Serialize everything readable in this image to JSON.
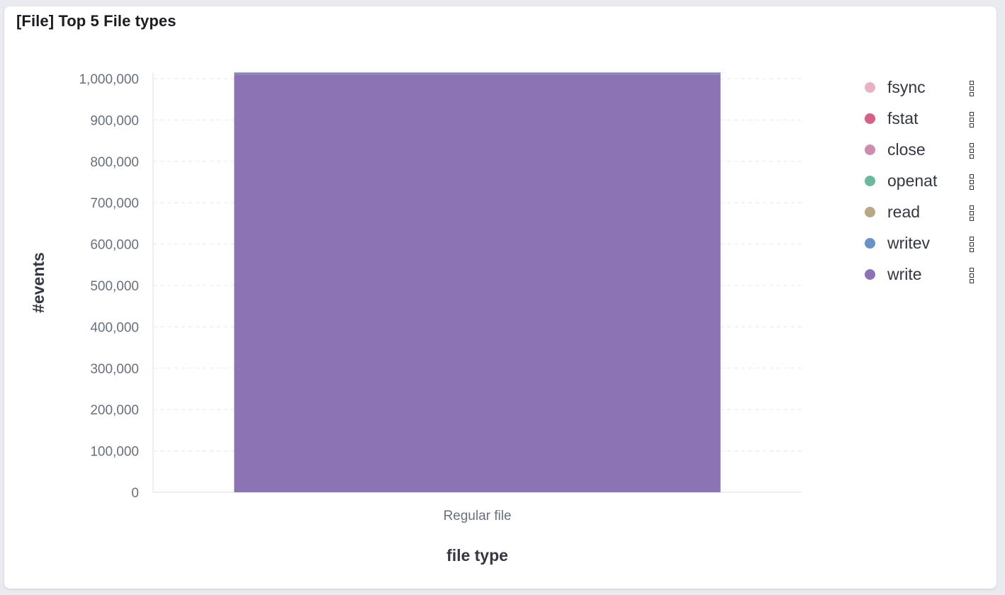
{
  "panel": {
    "title": "[File] Top 5 File types"
  },
  "chart_data": {
    "type": "bar",
    "stacked": true,
    "categories": [
      "Regular file"
    ],
    "xlabel": "file type",
    "ylabel": "#events",
    "ylim": [
      0,
      1000000
    ],
    "yticks": [
      "0",
      "100,000",
      "200,000",
      "300,000",
      "400,000",
      "500,000",
      "600,000",
      "700,000",
      "800,000",
      "900,000",
      "1,000,000"
    ],
    "grid": true,
    "legend_position": "right",
    "series": [
      {
        "name": "write",
        "color": "#8c73b4",
        "values": [
          1010000
        ]
      },
      {
        "name": "writev",
        "color": "#6a92c6",
        "values": [
          4000
        ]
      },
      {
        "name": "read",
        "color": "#b9a888",
        "values": [
          400
        ]
      },
      {
        "name": "openat",
        "color": "#6db79f",
        "values": [
          300
        ]
      },
      {
        "name": "close",
        "color": "#ca8eae",
        "values": [
          200
        ]
      },
      {
        "name": "fstat",
        "color": "#d36086",
        "values": [
          100
        ]
      },
      {
        "name": "fsync",
        "color": "#e7b2c4",
        "values": [
          50
        ]
      }
    ],
    "legend": [
      {
        "name": "fsync",
        "color": "#e7b2c4"
      },
      {
        "name": "fstat",
        "color": "#d36086"
      },
      {
        "name": "close",
        "color": "#ca8eae"
      },
      {
        "name": "openat",
        "color": "#6db79f"
      },
      {
        "name": "read",
        "color": "#b9a888"
      },
      {
        "name": "writev",
        "color": "#6a92c6"
      },
      {
        "name": "write",
        "color": "#8c73b4"
      }
    ]
  }
}
